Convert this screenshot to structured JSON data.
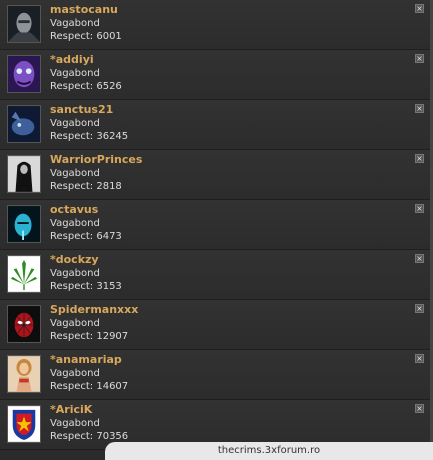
{
  "users": [
    {
      "name": "mastocanu",
      "rank": "Vagabond",
      "respect_label": "Respect:",
      "respect": "6001",
      "avatar": "dark-face-avatar"
    },
    {
      "name": "*addiyi",
      "rank": "Vagabond",
      "respect_label": "Respect:",
      "respect": "6526",
      "avatar": "purple-face-avatar"
    },
    {
      "name": "sanctus21",
      "rank": "Vagabond",
      "respect_label": "Respect:",
      "respect": "36245",
      "avatar": "blue-creature-avatar"
    },
    {
      "name": "WarriorPrinces",
      "rank": "Vagabond",
      "respect_label": "Respect:",
      "respect": "2818",
      "avatar": "dark-figure-avatar"
    },
    {
      "name": "octavus",
      "rank": "Vagabond",
      "respect_label": "Respect:",
      "respect": "6473",
      "avatar": "cyan-face-avatar"
    },
    {
      "name": "*dockzy",
      "rank": "Vagabond",
      "respect_label": "Respect:",
      "respect": "3153",
      "avatar": "cannabis-leaf-avatar"
    },
    {
      "name": "Spidermanxxx",
      "rank": "Vagabond",
      "respect_label": "Respect:",
      "respect": "12907",
      "avatar": "spiderman-avatar"
    },
    {
      "name": "*anamariap",
      "rank": "Vagabond",
      "respect_label": "Respect:",
      "respect": "14607",
      "avatar": "woman-photo-avatar"
    },
    {
      "name": "*AriciK",
      "rank": "Vagabond",
      "respect_label": "Respect:",
      "respect": "70356",
      "avatar": "steaua-crest-avatar"
    }
  ],
  "close_glyph": "×",
  "watermark": "thecrims.3xforum.ro",
  "colors": {
    "name": "#d8a85c",
    "text": "#dcdcdc",
    "background": "#2b2b2b"
  }
}
